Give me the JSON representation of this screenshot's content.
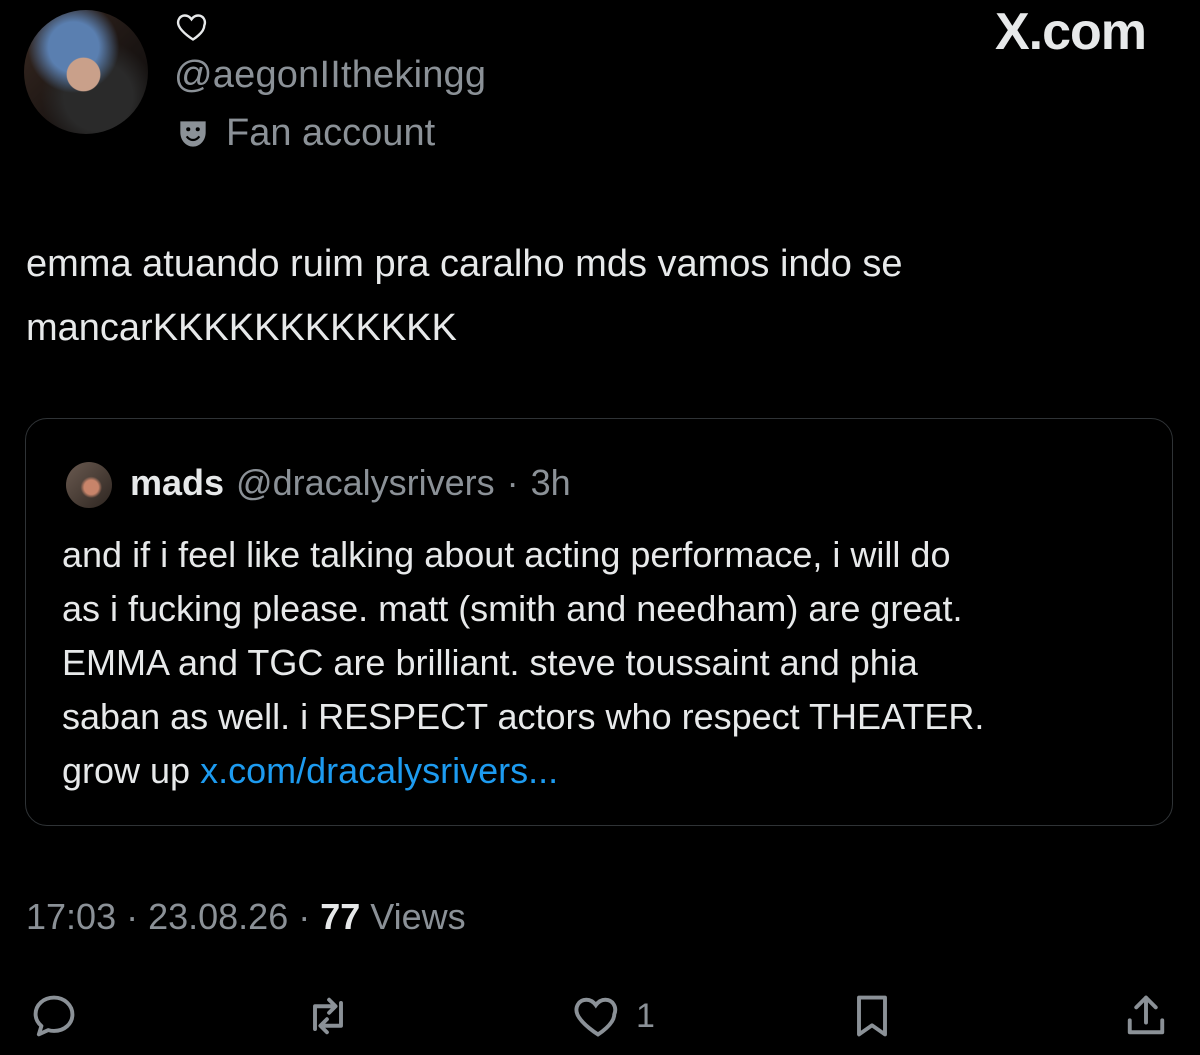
{
  "user": {
    "handle": "@aegonIIthekingg",
    "badge_label": "Fan account",
    "badge_icon": "theater-masks-icon"
  },
  "brand": "X.com",
  "tweet": {
    "line1": "emma atuando ruim pra caralho mds vamos indo se",
    "line2": "mancarKKKKKKKKKKKK"
  },
  "quote": {
    "name": "mads",
    "handle": "@dracalysrivers",
    "separator": "·",
    "time": "3h",
    "line1": "and if i feel like talking about acting performace, i will do",
    "line2": "as i fucking please. matt (smith and needham) are great.",
    "line3": "EMMA and TGC are brilliant. steve toussaint and phia",
    "line4": "saban as well. i RESPECT actors who respect THEATER.",
    "line5_prefix": "grow up ",
    "link": "x.com/dracalysrivers..."
  },
  "meta": {
    "time": "17:03",
    "separator": "·",
    "date": "23.08.26",
    "views_count": "77",
    "views_label": "Views"
  },
  "actions": {
    "like_count": "1",
    "icons": [
      "reply-icon",
      "retweet-icon",
      "like-icon",
      "bookmark-icon",
      "share-icon"
    ]
  },
  "colors": {
    "background": "#000000",
    "text": "#e7e9ea",
    "secondary": "#8b9197",
    "link": "#1d9bf0",
    "border": "#2f3336"
  }
}
